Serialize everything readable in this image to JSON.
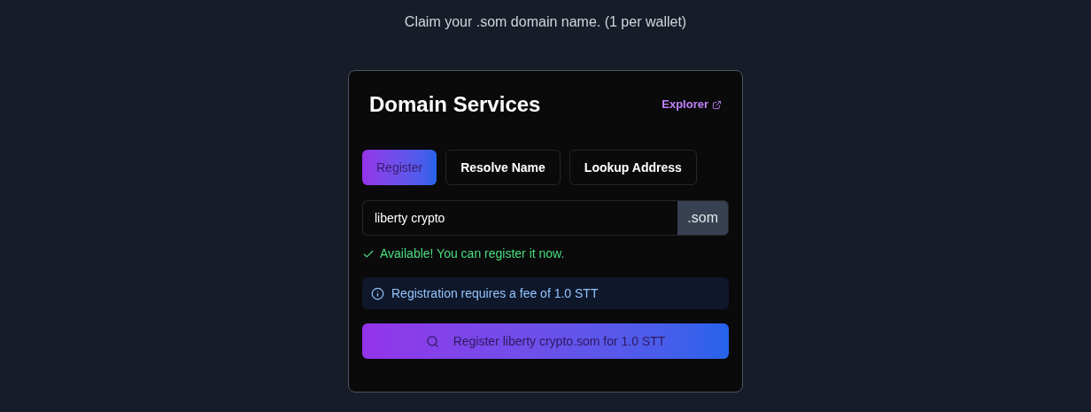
{
  "tagline": "Claim your .som domain name. (1 per wallet)",
  "card": {
    "title": "Domain Services",
    "explorer_link": "Explorer"
  },
  "tabs": [
    {
      "label": "Register",
      "selected": true
    },
    {
      "label": "Resolve Name",
      "selected": false
    },
    {
      "label": "Lookup Address",
      "selected": false
    }
  ],
  "domain_field": {
    "value": "liberty crypto",
    "suffix": ".som"
  },
  "status": {
    "available": true,
    "text": "Available! You can register it now."
  },
  "fee_notice": "Registration requires a fee of 1.0 STT",
  "register_button": "Register liberty crypto.som for 1.0 STT"
}
